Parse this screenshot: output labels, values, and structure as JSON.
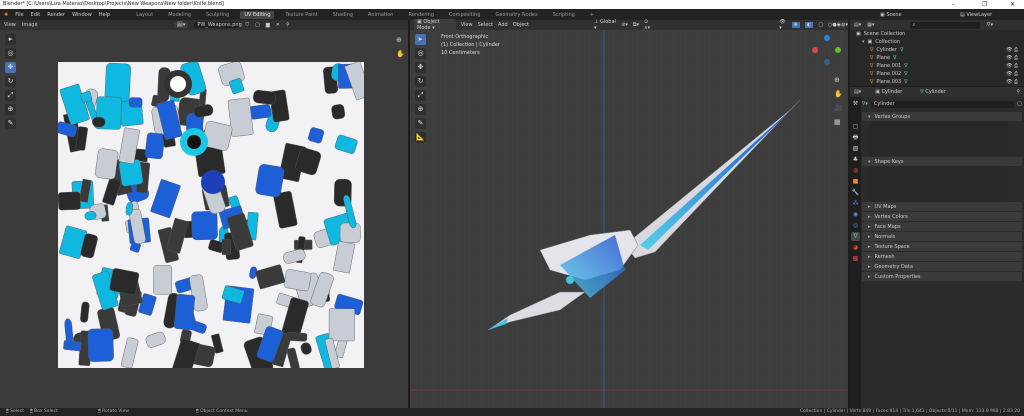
{
  "window": {
    "title": "Blender* [C:\\Users\\Liza Materas\\Desktop\\Projects\\New Weapons\\New folder\\Knife.blend]",
    "min": "–",
    "max": "❐",
    "close": "✕"
  },
  "menu": [
    "File",
    "Edit",
    "Render",
    "Window",
    "Help"
  ],
  "workspaces": [
    "Layout",
    "Modeling",
    "Sculpting",
    "UV Editing",
    "Texture Paint",
    "Shading",
    "Animation",
    "Rendering",
    "Compositing",
    "Geometry Nodes",
    "Scripting",
    "+"
  ],
  "active_workspace": "UV Editing",
  "scene": "Scene",
  "view_layer": "ViewLayer",
  "uv_editor": {
    "menu": [
      "View",
      "Image"
    ],
    "image_name": "PW_Weapons.png"
  },
  "viewport": {
    "mode": "Object Mode",
    "menu": [
      "View",
      "Select",
      "Add",
      "Object"
    ],
    "orientation": "Global",
    "overlay_lines": [
      "Front Orthographic",
      "(1) Collection | Cylinder",
      "10 Centimeters"
    ]
  },
  "outliner": {
    "search_placeholder": "",
    "root": "Scene Collection",
    "collection": "Collection",
    "items": [
      "Cylinder",
      "Plane",
      "Plane.001",
      "Plane.002",
      "Plane.003"
    ]
  },
  "properties": {
    "object": "Cylinder",
    "mesh": "Cylinder",
    "mesh_name": "Cylinder",
    "panels": [
      {
        "label": "Vertex Groups",
        "open": true
      },
      {
        "label": "Shape Keys",
        "open": true
      },
      {
        "label": "UV Maps"
      },
      {
        "label": "Vertex Colors"
      },
      {
        "label": "Face Maps"
      },
      {
        "label": "Normals"
      },
      {
        "label": "Texture Space"
      },
      {
        "label": "Remesh"
      },
      {
        "label": "Geometry Data"
      },
      {
        "label": "Custom Properties"
      }
    ]
  },
  "status": {
    "select": "Select",
    "box_select": "Box Select",
    "rotate": "Rotate View",
    "context": "Object Context Menu",
    "stats": "Collection | Cylinder | Verts:849 | Faces:814 | Tris:1,643 | Objects:0/11 | Mem: 133.9 MiB | 2.83.20"
  },
  "colors": {
    "accent": "#4772b3",
    "blade_blue": "#2a6fd6",
    "grid_bg": "#3d3d3d"
  }
}
